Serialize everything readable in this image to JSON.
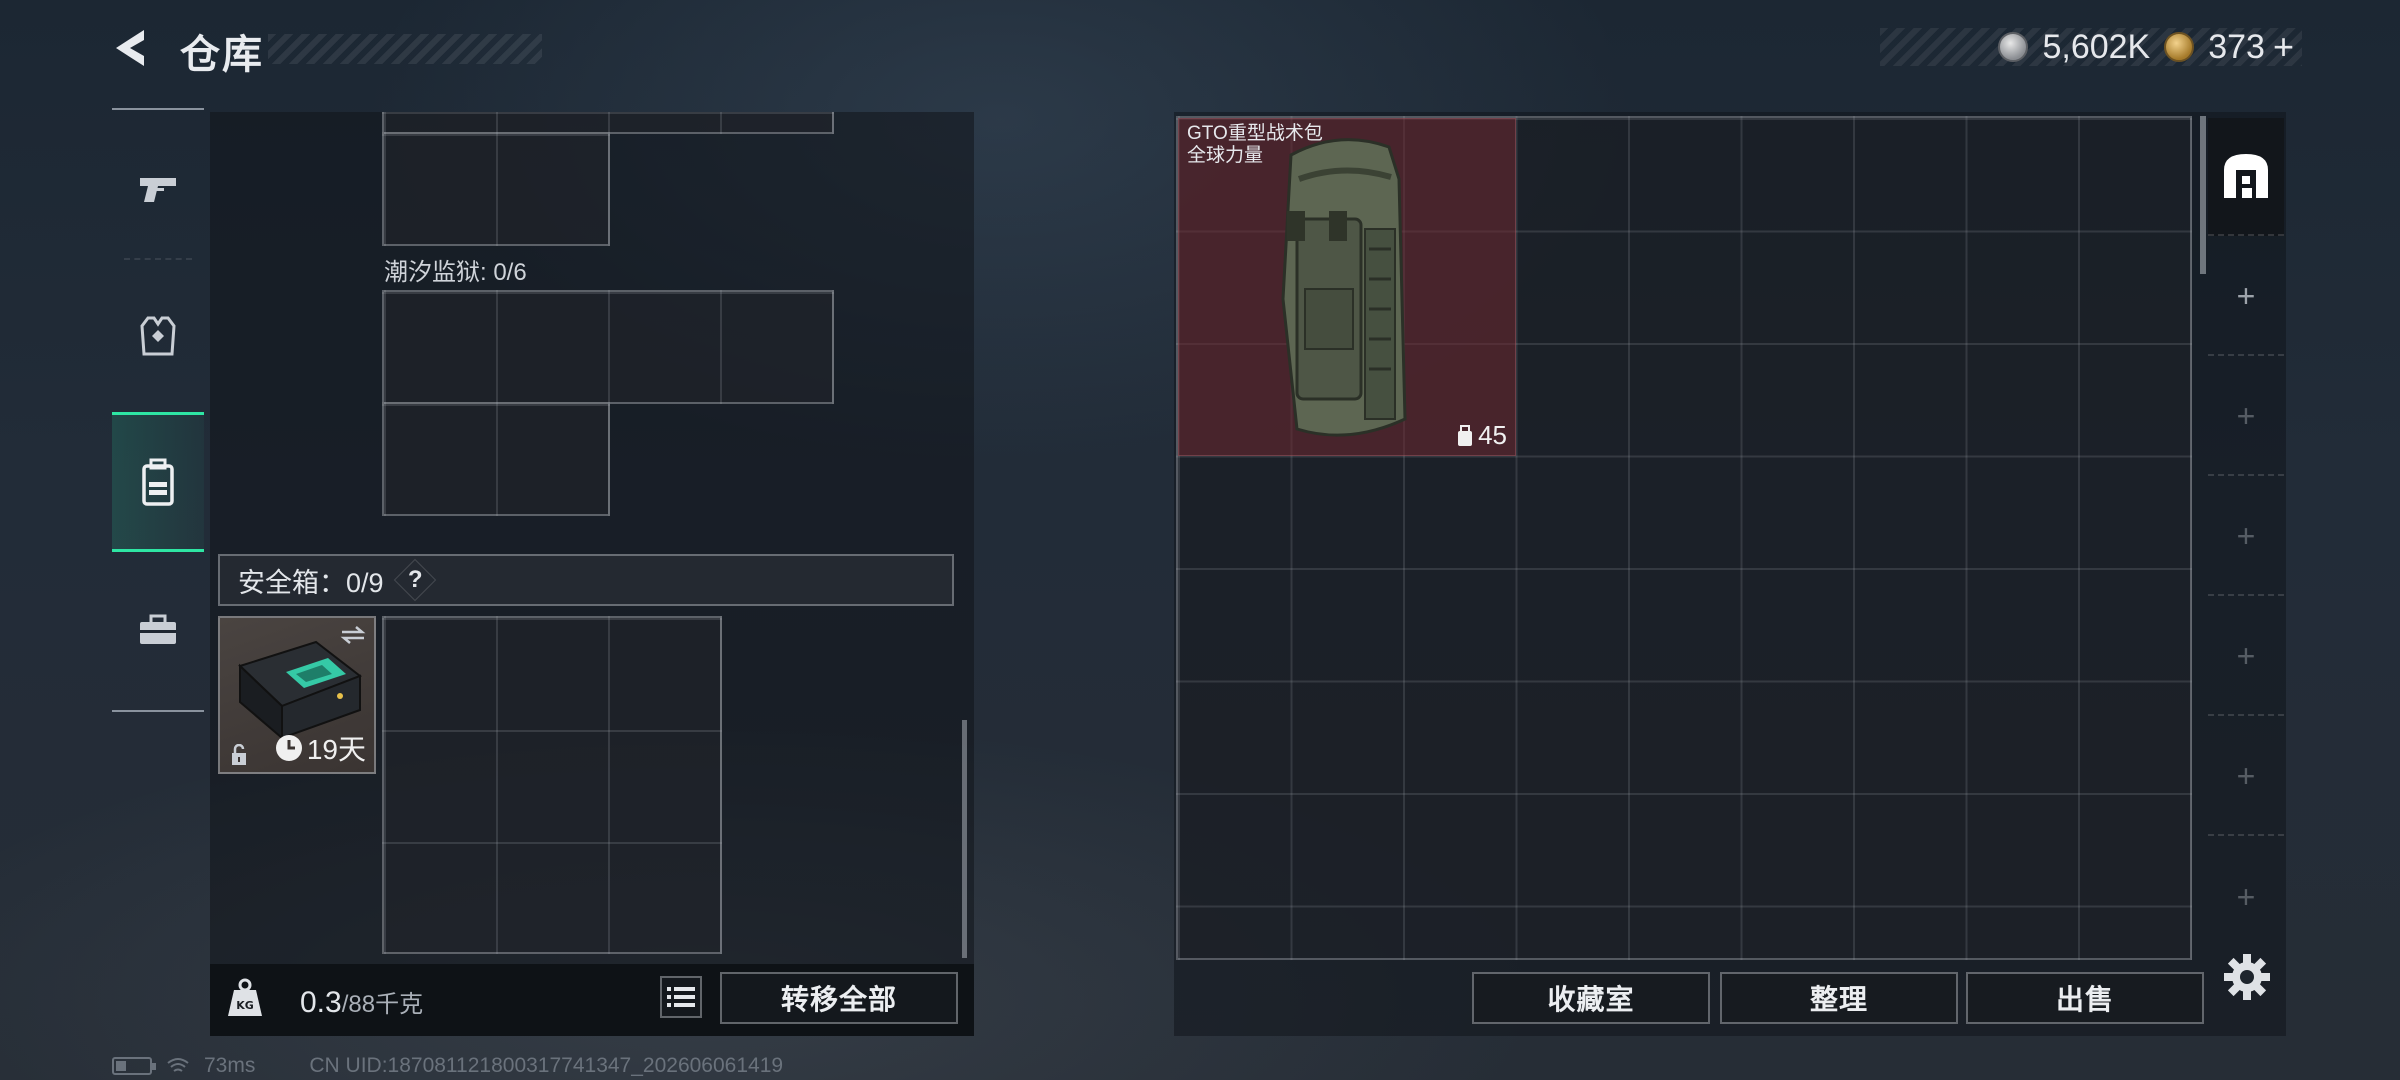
{
  "header": {
    "title": "仓库",
    "back_icon": "back-arrow-icon"
  },
  "currency": {
    "silver_icon": "silver-coin-icon",
    "silver_value": "5,602K",
    "gold_icon": "gold-coin-icon",
    "gold_value": "373",
    "add_label": "+"
  },
  "categories": [
    {
      "name": "weapons",
      "icon": "pistol-icon",
      "active": false
    },
    {
      "name": "equipment",
      "icon": "vest-icon",
      "active": false
    },
    {
      "name": "backpack",
      "icon": "backpack-icon",
      "active": true
    },
    {
      "name": "supplies",
      "icon": "toolbox-icon",
      "active": false
    }
  ],
  "left": {
    "section_label": "潮汐监狱: 0/6",
    "safebox_label": "安全箱：0/9",
    "safebox_help": "?",
    "safebox_item": {
      "icon": "safebox-icon",
      "days_left": "19天",
      "lock_icon": "lock-icon",
      "swap_icon": "swap-icon",
      "clock_icon": "clock-icon"
    },
    "weight_value": "0.3",
    "weight_max": "/88千克",
    "weight_icon": "kg-weight-icon",
    "list_icon": "list-icon",
    "transfer_all_label": "转移全部"
  },
  "storage": {
    "item": {
      "name_line1": "GTO重型战术包",
      "name_line2": "全球力量",
      "capacity": "45",
      "capacity_icon": "backpack-capacity-icon"
    },
    "tabs": [
      "storage-home-icon",
      "+",
      "+",
      "+",
      "+",
      "+",
      "+"
    ],
    "buttons": {
      "collection_label": "收藏室",
      "sort_label": "整理",
      "sell_label": "出售"
    },
    "settings_icon": "gear-icon"
  },
  "status": {
    "ping": "73ms",
    "uid": "CN UID:1870811218003177413​47_202606061419"
  }
}
